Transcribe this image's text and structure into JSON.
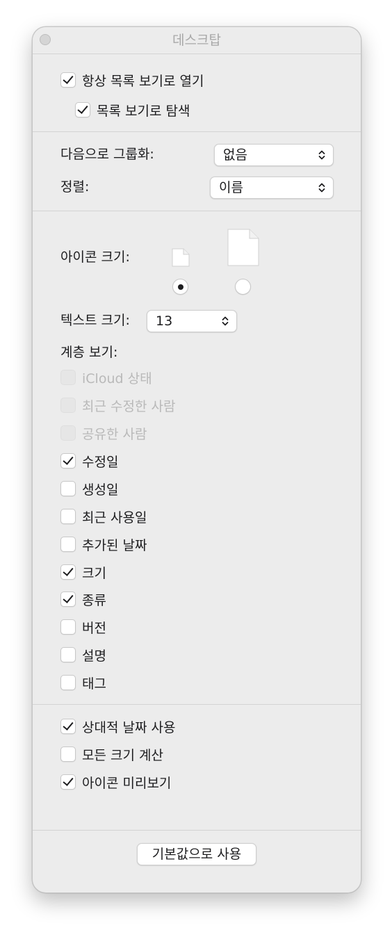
{
  "window": {
    "title": "데스크탑"
  },
  "browse": {
    "always_list": {
      "label": "항상 목록 보기로 열기",
      "checked": true
    },
    "browse_list": {
      "label": "목록 보기로 탐색",
      "checked": true
    }
  },
  "grouping": {
    "group_by_label": "다음으로 그룹화:",
    "group_by_value": "없음",
    "sort_label": "정렬:",
    "sort_value": "이름"
  },
  "view": {
    "icon_size_label": "아이콘 크기:",
    "icon_size_selected": "small",
    "text_size_label": "텍스트 크기:",
    "text_size_value": "13",
    "columns_label": "계층 보기:",
    "columns": [
      {
        "label": "iCloud 상태",
        "checked": false,
        "disabled": true
      },
      {
        "label": "최근 수정한 사람",
        "checked": false,
        "disabled": true
      },
      {
        "label": "공유한 사람",
        "checked": false,
        "disabled": true
      },
      {
        "label": "수정일",
        "checked": true,
        "disabled": false
      },
      {
        "label": "생성일",
        "checked": false,
        "disabled": false
      },
      {
        "label": "최근 사용일",
        "checked": false,
        "disabled": false
      },
      {
        "label": "추가된 날짜",
        "checked": false,
        "disabled": false
      },
      {
        "label": "크기",
        "checked": true,
        "disabled": false
      },
      {
        "label": "종류",
        "checked": true,
        "disabled": false
      },
      {
        "label": "버전",
        "checked": false,
        "disabled": false
      },
      {
        "label": "설명",
        "checked": false,
        "disabled": false
      },
      {
        "label": "태그",
        "checked": false,
        "disabled": false
      }
    ]
  },
  "options": {
    "relative_dates": {
      "label": "상대적 날짜 사용",
      "checked": true
    },
    "calc_sizes": {
      "label": "모든 크기 계산",
      "checked": false
    },
    "icon_preview": {
      "label": "아이콘 미리보기",
      "checked": true
    }
  },
  "footer": {
    "defaults_button": "기본값으로 사용"
  }
}
